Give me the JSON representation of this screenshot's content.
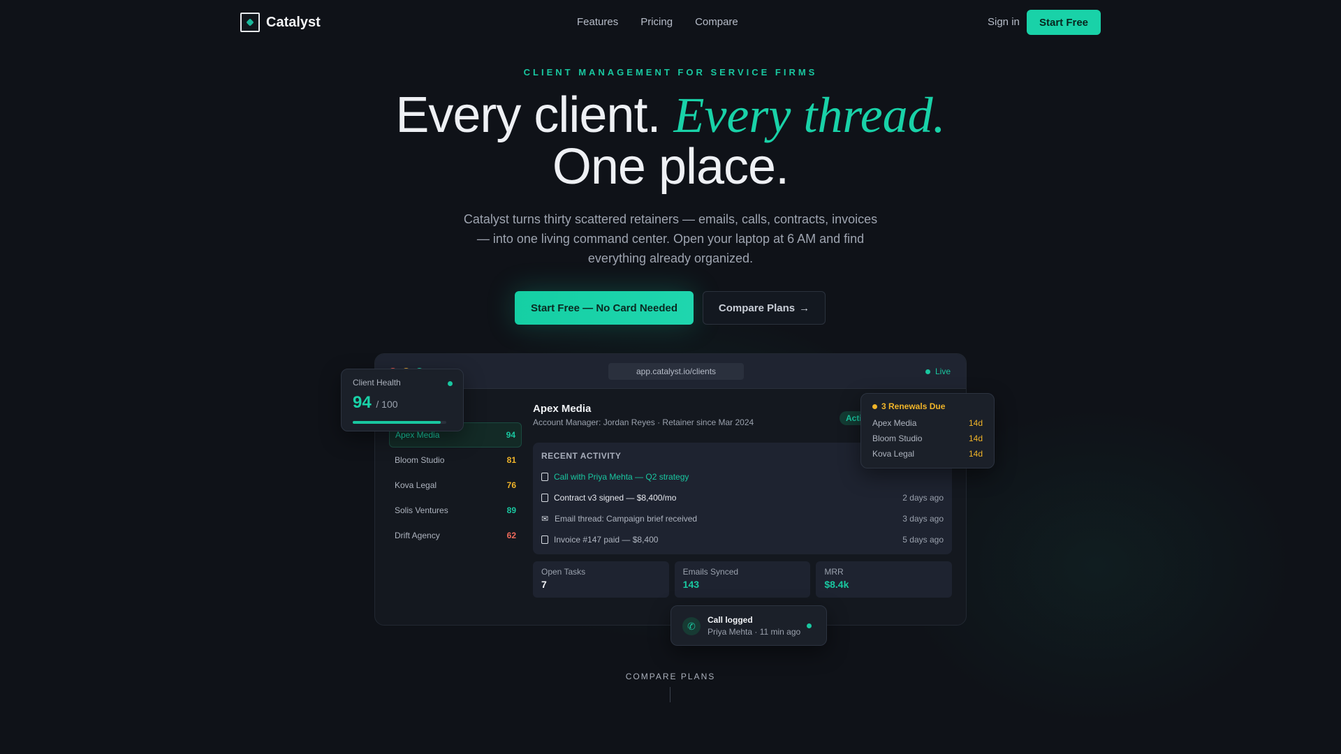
{
  "nav": {
    "brand": "Catalyst",
    "links": [
      "Features",
      "Pricing",
      "Compare"
    ],
    "signin": "Sign in",
    "cta": "Start Free"
  },
  "hero": {
    "eyebrow": "CLIENT MANAGEMENT FOR SERVICE FIRMS",
    "headline_a": "Every client. ",
    "headline_accent": "Every thread.",
    "headline_b": "One place.",
    "subtitle": "Catalyst turns thirty scattered retainers — emails, calls, contracts, invoices — into one living command center. Open your laptop at 6 AM and find everything already organized.",
    "cta_primary": "Start Free — No Card Needed",
    "cta_secondary": "Compare Plans",
    "cta_secondary_arrow": "→"
  },
  "app": {
    "url": "app.catalyst.io/clients",
    "live": "Live",
    "window_dot_colors": [
      "#e5534b",
      "#e0a030",
      "#19c7a0"
    ],
    "clients": [
      {
        "name": "Apex Media",
        "score": "94",
        "color": "#19c7a0"
      },
      {
        "name": "Bloom Studio",
        "score": "81",
        "color": "#f0b429"
      },
      {
        "name": "Kova Legal",
        "score": "76",
        "color": "#f0b429"
      },
      {
        "name": "Solis Ventures",
        "score": "89",
        "color": "#19c7a0"
      },
      {
        "name": "Drift Agency",
        "score": "62",
        "color": "#f06a5b"
      }
    ],
    "selected": {
      "name": "Apex Media",
      "meta": "Account Manager: Jordan Reyes · Retainer since Mar 2024",
      "badge": "Active"
    },
    "activity_title": "RECENT ACTIVITY",
    "activity": [
      {
        "icon": "phone-doc-icon",
        "text": "Call with Priya Mehta — Q2 strategy",
        "time": "",
        "color": "#19c7a0"
      },
      {
        "icon": "document-icon",
        "text": "Contract v3 signed — $8,400/mo",
        "time": "2 days ago",
        "color": "#e6e8ee"
      },
      {
        "icon": "mail-icon",
        "text": "Email thread: Campaign brief received",
        "time": "3 days ago",
        "color": "#aeb4bf"
      },
      {
        "icon": "document-icon",
        "text": "Invoice #147 paid — $8,400",
        "time": "5 days ago",
        "color": "#aeb4bf"
      }
    ],
    "stats": [
      {
        "label": "Open Tasks",
        "value": "7",
        "color": "#f1f3f6"
      },
      {
        "label": "Emails Synced",
        "value": "143",
        "color": "#19c7a0"
      },
      {
        "label": "MRR",
        "value": "$8.4k",
        "color": "#19c7a0"
      }
    ]
  },
  "health": {
    "label": "Client Health",
    "score": "94",
    "out_of": "/ 100",
    "fraction": 0.94
  },
  "renewals": {
    "title": "3 Renewals Due",
    "items": [
      {
        "name": "Apex Media",
        "days": "14d"
      },
      {
        "name": "Bloom Studio",
        "days": "14d"
      },
      {
        "name": "Kova Legal",
        "days": "14d"
      }
    ]
  },
  "call": {
    "title": "Call logged",
    "subtitle": "Priya Mehta · 11 min ago"
  },
  "footer": {
    "compare": "COMPARE PLANS"
  }
}
